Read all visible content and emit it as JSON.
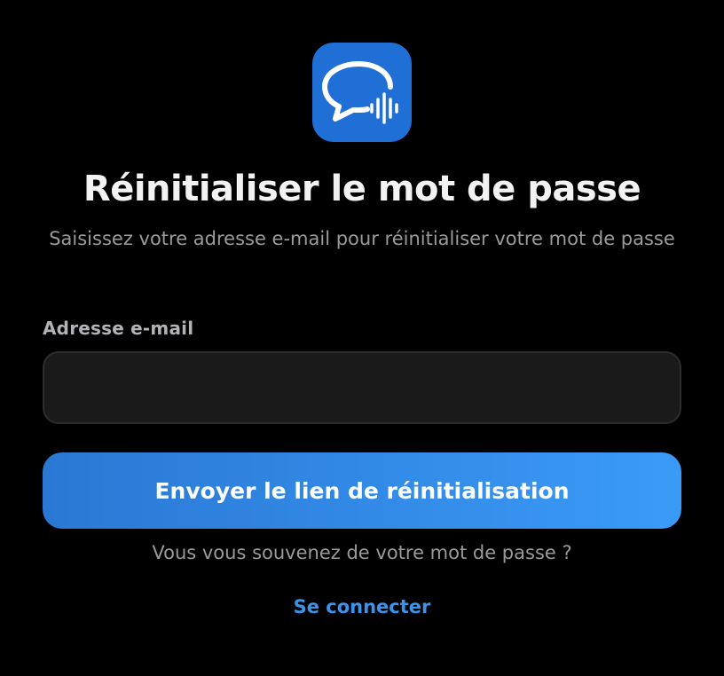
{
  "app": {
    "icon": "speech-bubble-waveform-icon",
    "icon_color": "#1f6fd6"
  },
  "header": {
    "title": "Réinitialiser le mot de passe",
    "subtitle": "Saisissez votre adresse e-mail pour réinitialiser votre mot de passe"
  },
  "form": {
    "email_label": "Adresse e-mail",
    "email_value": "",
    "email_placeholder": "",
    "submit_label": "Envoyer le lien de réinitialisation",
    "button_gradient": [
      "#2a78d4",
      "#3a9bf7"
    ]
  },
  "footer": {
    "remember_text": "Vous vous souvenez de votre mot de passe ?",
    "login_link": "Se connecter",
    "link_color": "#3c93ec"
  }
}
